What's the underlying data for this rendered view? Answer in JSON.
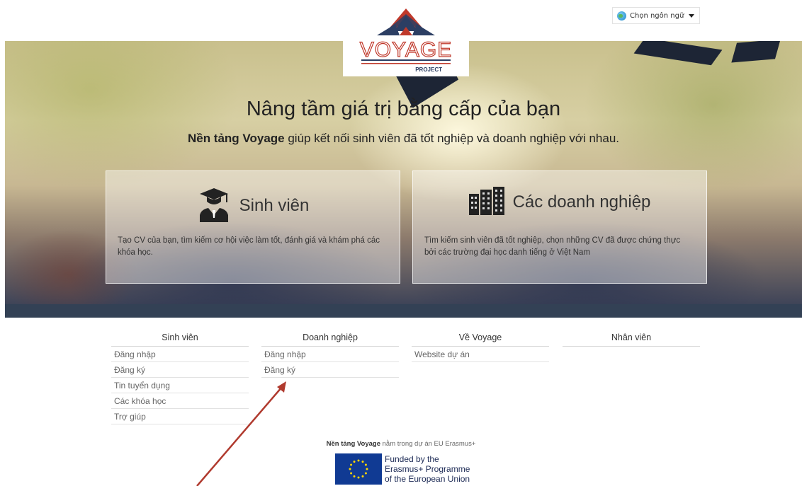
{
  "language_selector": {
    "label": "Chọn ngôn ngữ"
  },
  "logo": {
    "brand": "VOYAGE",
    "sub": "PROJECT"
  },
  "hero": {
    "title": "Nâng tầm giá trị bằng cấp của bạn",
    "subtitle_bold": "Nền tảng Voyage",
    "subtitle_rest": " giúp kết nối sinh viên đã tốt nghiệp và doanh nghiệp với nhau."
  },
  "cards": {
    "student": {
      "title": "Sinh viên",
      "description": "Tạo CV của bạn, tìm kiếm cơ hội việc làm tốt, đánh giá và khám phá các khóa học."
    },
    "business": {
      "title": "Các doanh nghiệp",
      "description": "Tìm kiếm sinh viên đã tốt nghiệp, chọn những CV đã được chứng thực bởi các trường đại học danh tiếng ở Việt Nam"
    }
  },
  "footer": {
    "columns": [
      {
        "heading": "Sinh viên",
        "links": [
          "Đăng nhập",
          "Đăng ký",
          "Tin tuyển dụng",
          "Các khóa học",
          "Trợ giúp"
        ]
      },
      {
        "heading": "Doanh nghiệp",
        "links": [
          "Đăng nhập",
          "Đăng ký"
        ]
      },
      {
        "heading": "Về Voyage",
        "links": [
          "Website dự án"
        ]
      },
      {
        "heading": "Nhân viên",
        "links": []
      }
    ],
    "erasmus_bold": "Nền tảng Voyage",
    "erasmus_rest": " nằm trong dự án EU Erasmus+",
    "eu_line1": "Funded by the",
    "eu_line2": "Erasmus+ Programme",
    "eu_line3": "of the European Union"
  },
  "colors": {
    "band": "#334155",
    "logo_red": "#c0392b",
    "logo_navy": "#2c3e63",
    "eu_blue": "#103a93",
    "annotation_arrow": "#b03a2e"
  },
  "icons": {
    "language": "globe-icon",
    "dropdown": "caret-down-icon",
    "student": "graduate-icon",
    "business": "buildings-icon",
    "eu": "eu-flag-icon"
  }
}
